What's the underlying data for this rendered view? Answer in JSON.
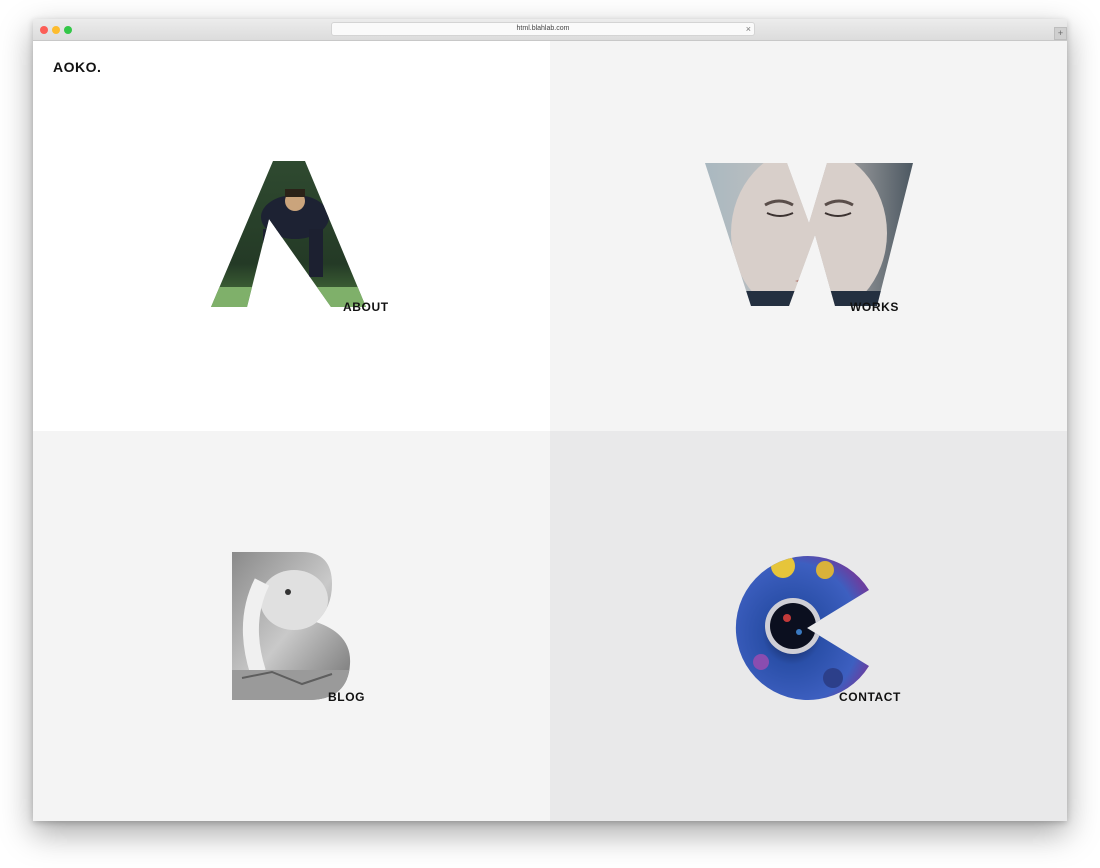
{
  "browser": {
    "url": "html.blahlab.com",
    "close_glyph": "×",
    "new_tab_glyph": "+"
  },
  "site": {
    "logo": "AOKO."
  },
  "nav": {
    "about": "ABOUT",
    "works": "WORKS",
    "blog": "BLOG",
    "contact": "CONTACT"
  },
  "colors": {
    "quad_about": "#ffffff",
    "quad_works": "#f4f4f4",
    "quad_blog": "#f4f4f4",
    "quad_contact": "#e9e9ea",
    "text": "#111111"
  }
}
